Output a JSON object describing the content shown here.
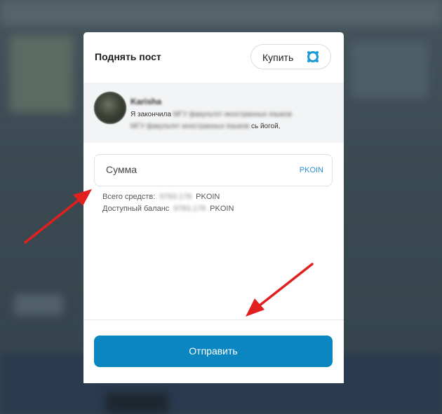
{
  "modal": {
    "title": "Поднять пост",
    "buy_label": "Купить",
    "buy_icon": "pkoin-coin-icon"
  },
  "post": {
    "author": "Karisha",
    "line1_prefix": "Я закончила",
    "line1_blurred": "МГУ факультет иностранных языков",
    "line2_blurred": "МГУ факультет иностранных языков",
    "line2_suffix": "сь йогой,"
  },
  "amount": {
    "placeholder": "Сумма",
    "value": "",
    "unit": "PKOIN"
  },
  "balances": {
    "total_label": "Всего средств:",
    "total_value": "9783.178",
    "total_unit": "PKOIN",
    "available_label": "Доступный баланс",
    "available_value": "9783.178",
    "available_unit": "PKOIN"
  },
  "send_label": "Отправить",
  "colors": {
    "accent": "#0b86c0",
    "unit_link": "#2b8fd0",
    "annotation_arrow": "#e21f1f"
  }
}
